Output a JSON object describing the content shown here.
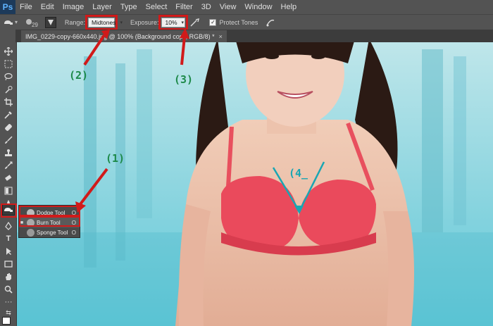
{
  "app": {
    "logo": "Ps"
  },
  "menu": [
    "File",
    "Edit",
    "Image",
    "Layer",
    "Type",
    "Select",
    "Filter",
    "3D",
    "View",
    "Window",
    "Help"
  ],
  "options": {
    "brush_size": "29",
    "range_label": "Range:",
    "range_value": "Midtones",
    "exposure_label": "Exposure:",
    "exposure_value": "10%",
    "protect_tones_label": "Protect Tones",
    "protect_tones_checked": true
  },
  "document_tab": {
    "title": "IMG_0229-copy-660x440.jpg @ 100% (Background copy, RGB/8) *",
    "close": "×"
  },
  "flyout": [
    {
      "label": "Dodge Tool",
      "shortcut": "O",
      "active": false
    },
    {
      "label": "Burn Tool",
      "shortcut": "O",
      "active": true
    },
    {
      "label": "Sponge Tool",
      "shortcut": "O",
      "active": false
    }
  ],
  "annotations": {
    "n1": "(1)",
    "n2": "(2)",
    "n3": "(3)",
    "n4": "(4_"
  },
  "colors": {
    "annotation_red": "#d11a1a",
    "annotation_green": "#1e8a4a",
    "annotation_cyan": "#19a6b3",
    "ui_gray": "#535353"
  }
}
